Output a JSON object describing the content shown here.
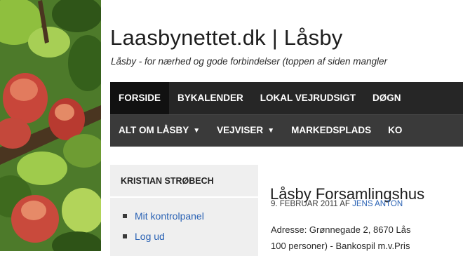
{
  "site": {
    "title": "Laasbynettet.dk | Låsby",
    "tagline": "Låsby - for nærhed og gode forbindelser (toppen af siden mangler"
  },
  "nav_primary": [
    {
      "label": "FORSIDE",
      "active": true
    },
    {
      "label": "BYKALENDER"
    },
    {
      "label": "LOKAL VEJRUDSIGT"
    },
    {
      "label": "DØGN"
    }
  ],
  "nav_secondary": [
    {
      "label": "ALT OM LÅSBY",
      "has_dropdown": true
    },
    {
      "label": "VEJVISER",
      "has_dropdown": true
    },
    {
      "label": "MARKEDSPLADS"
    },
    {
      "label": "KO"
    }
  ],
  "sidebar": {
    "widget_title": "KRISTIAN STRØBECH",
    "links": [
      "Mit kontrolpanel",
      "Log ud"
    ]
  },
  "post": {
    "title": "Låsby Forsamlingshus",
    "date": "9. FEBRUAR 2011",
    "by": "AF",
    "author": "JENS ANTON",
    "body_line1": "Adresse: Grønnegade 2, 8670 Lås",
    "body_line2": "100 personer) - Bankospil m.v.Pris"
  },
  "colors": {
    "nav_primary_bg": "#262626",
    "nav_secondary_bg": "#3a3a3a",
    "link": "#2a62b4"
  }
}
